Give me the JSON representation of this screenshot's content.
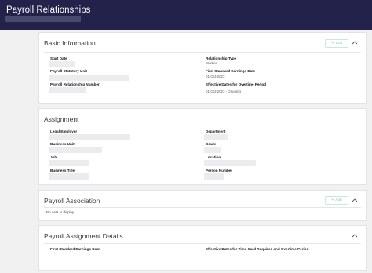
{
  "header": {
    "title": "Payroll Relationships"
  },
  "basic_information": {
    "title": "Basic Information",
    "edit_label": "Edit",
    "edit_icon": "pencil-icon",
    "fields": {
      "start_date": {
        "label": "Start Date"
      },
      "payroll_statutory_unit": {
        "label": "Payroll Statutory Unit"
      },
      "payroll_relationship_number": {
        "label": "Payroll Relationship Number"
      },
      "relationship_type": {
        "label": "Relationship Type",
        "value": "Worker"
      },
      "first_standard_earnings_date": {
        "label": "First Standard Earnings Date",
        "value": "01-Oct-2023"
      },
      "effective_dates_overtime": {
        "label": "Effective Dates for Overtime Period",
        "value": "01-Oct-2023 - Ongoing"
      }
    }
  },
  "assignment": {
    "title": "Assignment",
    "fields": {
      "legal_employer": {
        "label": "Legal Employer"
      },
      "business_unit": {
        "label": "Business Unit"
      },
      "job": {
        "label": "Job"
      },
      "business_title": {
        "label": "Business Title"
      },
      "department": {
        "label": "Department"
      },
      "grade": {
        "label": "Grade"
      },
      "location": {
        "label": "Location"
      },
      "person_number": {
        "label": "Person Number"
      }
    }
  },
  "payroll_association": {
    "title": "Payroll Association",
    "add_label": "Add",
    "add_icon": "plus-icon",
    "empty_text": "No data to display."
  },
  "payroll_assignment_details": {
    "title": "Payroll Assignment Details",
    "fields": {
      "first_standard_earnings_date": {
        "label": "First Standard Earnings Date"
      },
      "effective_dates_time_card": {
        "label": "Effective Dates for Time Card Required and Overtime Period",
        "value": "-"
      }
    }
  },
  "colors": {
    "header_bg": "#23224a",
    "accent": "#8fc6c7",
    "page_bg": "#f1f1f2"
  }
}
